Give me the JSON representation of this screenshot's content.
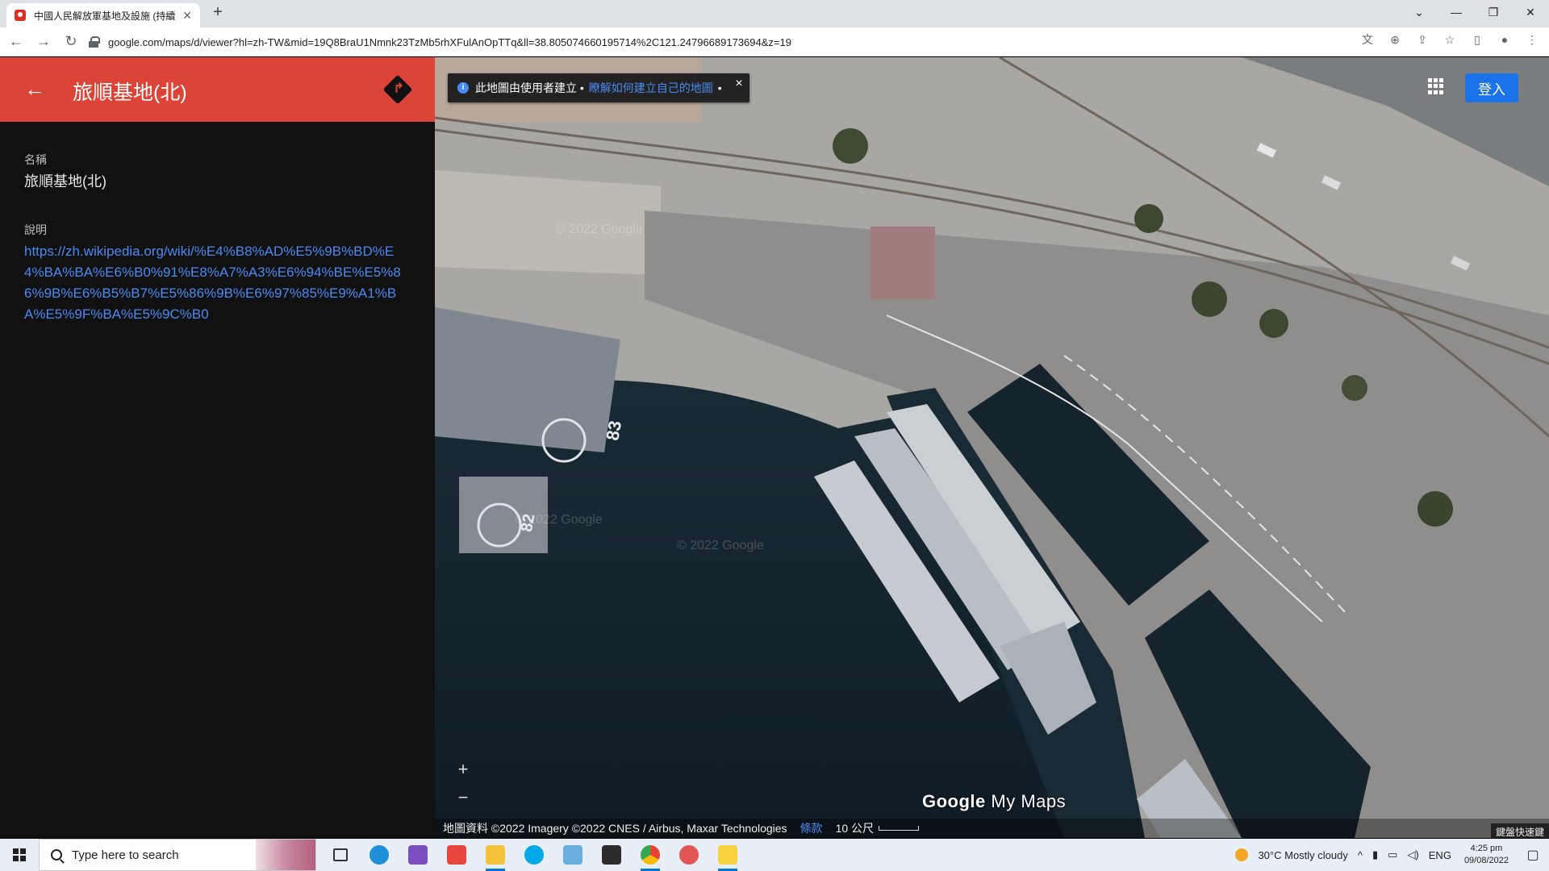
{
  "browser": {
    "tab_title": "中國人民解放軍基地及設施 (持續…",
    "url": "google.com/maps/d/viewer?hl=zh-TW&mid=19Q8BraU1Nmnk23TzMb5rhXFulAnOpTTq&ll=38.805074660195714%2C121.24796689173694&z=19",
    "new_tab": "+",
    "minimize": "—",
    "restore": "❐",
    "close": "✕",
    "back": "←",
    "forward": "→",
    "reload": "↻"
  },
  "panel": {
    "title": "旅順基地(北)",
    "name_label": "名稱",
    "name_value": "旅順基地(北)",
    "desc_label": "說明",
    "desc_link": "https://zh.wikipedia.org/wiki/%E4%B8%AD%E5%9B%BD%E4%BA%BA%E6%B0%91%E8%A7%A3%E6%94%BE%E5%86%9B%E6%B5%B7%E5%86%9B%E6%97%85%E9%A1%BA%E5%9F%BA%E5%9C%B0"
  },
  "map": {
    "banner_text": "此地圖由使用者建立 •",
    "banner_link": "瞭解如何建立自己的地圖",
    "banner_end": "•",
    "signin": "登入",
    "zoom_in": "+",
    "zoom_out": "−",
    "brand_google": "Google",
    "brand_mymaps": "My Maps",
    "attribution": "地圖資料 ©2022 Imagery ©2022 CNES / Airbus, Maxar Technologies",
    "terms": "條款",
    "scale_label": "10 公尺",
    "keyboard_hint": "鍵盤快速鍵",
    "watermark": "© 2022 Google",
    "deck_label_1": "83",
    "deck_label_2": "82"
  },
  "taskbar": {
    "search_placeholder": "Type here to search",
    "weather": "30°C  Mostly cloudy",
    "language": "ENG",
    "time": "4:25 pm",
    "date": "09/08/2022"
  },
  "colors": {
    "header_red": "#db4437",
    "link_blue": "#4a8af4",
    "signin_blue": "#1a73e8"
  }
}
